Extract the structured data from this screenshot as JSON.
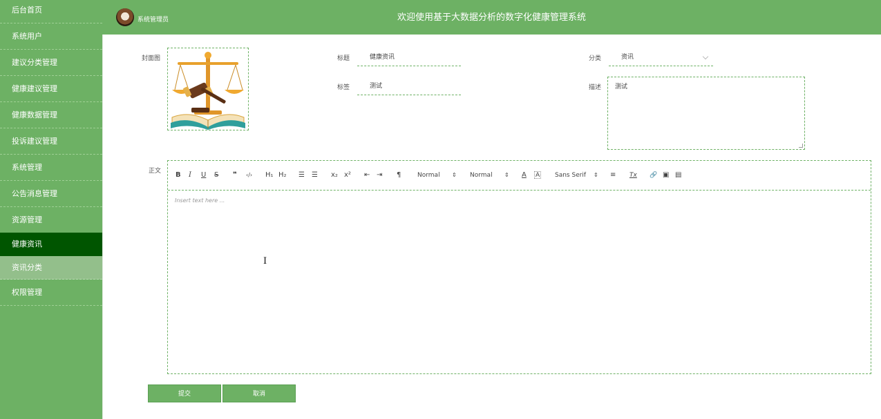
{
  "sidebar": {
    "items": [
      {
        "label": "后台首页"
      },
      {
        "label": "系统用户"
      },
      {
        "label": "建议分类管理"
      },
      {
        "label": "健康建议管理"
      },
      {
        "label": "健康数据管理"
      },
      {
        "label": "投诉建议管理"
      },
      {
        "label": "系统管理"
      },
      {
        "label": "公告消息管理"
      },
      {
        "label": "资源管理"
      },
      {
        "label": "健康资讯"
      },
      {
        "label": "资讯分类"
      },
      {
        "label": "权限管理"
      }
    ],
    "active_item": "健康资讯",
    "sub_selected": "资讯分类"
  },
  "header": {
    "role": "系统管理员",
    "title": "欢迎使用基于大数据分析的数字化健康管理系统",
    "avatar_icon": "user-avatar-icon"
  },
  "form": {
    "cover": {
      "label": "封面图",
      "image_icon": "justice-scale-book-icon"
    },
    "title": {
      "label": "标题",
      "value": "健康资讯"
    },
    "tag": {
      "label": "标签",
      "value": "测试"
    },
    "category": {
      "label": "分类",
      "value": "资讯"
    },
    "description": {
      "label": "描述",
      "value": "测试"
    },
    "body": {
      "label": "正文",
      "placeholder": "Insert text here ...",
      "toolbar": {
        "bold": "B",
        "italic": "I",
        "underline": "U",
        "strike": "S",
        "quote": "❞",
        "code": "‹/›",
        "h1": "H₁",
        "h2": "H₂",
        "ordered": "☰",
        "bullet": "☰",
        "sub": "x₂",
        "sup": "x²",
        "outdent": "⇤",
        "indent": "⇥",
        "direction": "¶",
        "size_select": "Normal",
        "header_select": "Normal",
        "color": "A",
        "background": "A",
        "font_select": "Sans Serif",
        "align": "≡",
        "clean": "Tx",
        "link": "🔗",
        "image": "▣",
        "video": "▤"
      }
    }
  },
  "buttons": {
    "submit": "提交",
    "cancel": "取消"
  },
  "colors": {
    "primary": "#6db164",
    "active": "#005500",
    "sub_selected": "#93bf8b"
  }
}
